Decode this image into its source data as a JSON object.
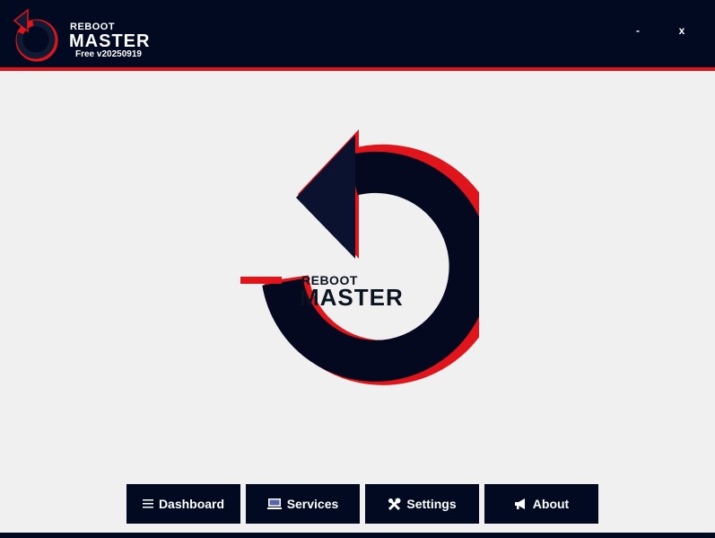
{
  "app": {
    "brand_top": "REBOOT",
    "brand_main": "MASTER",
    "version": "Free v20250919"
  },
  "window_controls": {
    "minimize_label": "-",
    "close_label": "x"
  },
  "hero": {
    "brand_top": "REBOOT",
    "brand_main": "MASTER"
  },
  "nav": {
    "items": [
      {
        "label": "Dashboard",
        "icon": "menu-icon"
      },
      {
        "label": "Services",
        "icon": "services-icon"
      },
      {
        "label": "Settings",
        "icon": "tools-icon"
      },
      {
        "label": "About",
        "icon": "megaphone-icon"
      }
    ]
  },
  "colors": {
    "navy": "#020a22",
    "accent_red": "#e0151b",
    "background": "#f0f0f0"
  }
}
